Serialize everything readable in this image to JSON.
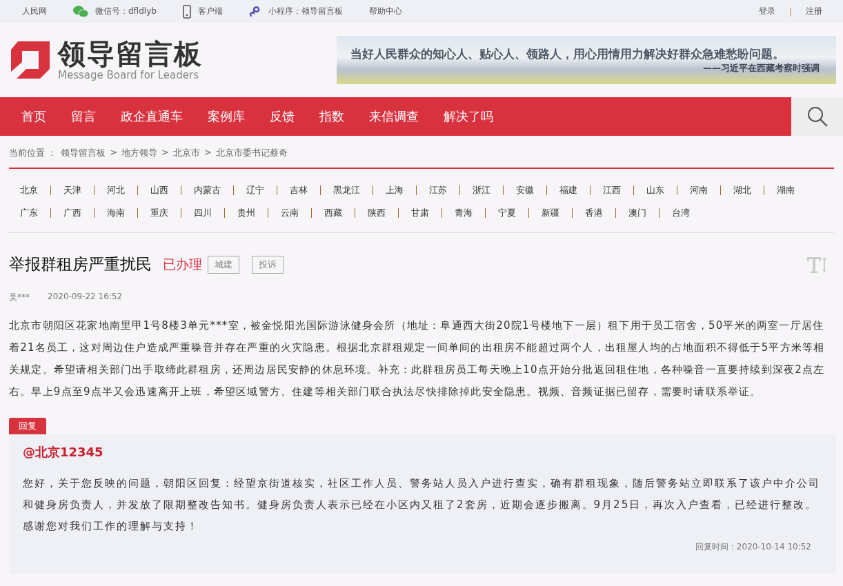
{
  "top_bar": {
    "links": [
      {
        "kind": "text",
        "label": "人民网"
      },
      {
        "kind": "wechat",
        "label": "微信号：dfldlyb"
      },
      {
        "kind": "phone",
        "label": "客户端"
      },
      {
        "kind": "miniapp",
        "label": "小程序：领导留言板"
      },
      {
        "kind": "text",
        "label": "帮助中心"
      }
    ],
    "login": "登录",
    "separator": "|",
    "register": "注册"
  },
  "header": {
    "logo_title": "领导留言板",
    "logo_subtitle": "Message Board for Leaders",
    "banner_quote": "当好人民群众的知心人、贴心人、领路人，用心用情用力解决好群众急难愁盼问题。",
    "banner_source": "——习近平在西藏考察时强调"
  },
  "nav": {
    "items": [
      {
        "label": "首页",
        "selected": false
      },
      {
        "label": "留言",
        "selected": false
      },
      {
        "label": "政企直通车",
        "selected": false
      },
      {
        "label": "案例库",
        "selected": false
      },
      {
        "label": "反馈",
        "selected": false
      },
      {
        "label": "指数",
        "selected": false
      },
      {
        "label": "来信调查",
        "selected": false
      },
      {
        "label": "解决了吗",
        "selected": false
      }
    ]
  },
  "breadcrumb": {
    "label": "当前位置 ：",
    "items": [
      "领导留言板",
      "地方领导",
      "北京市",
      "北京市委书记蔡奇"
    ],
    "separator": ">"
  },
  "regions": [
    [
      "北京",
      "天津",
      "河北",
      "山西",
      "内蒙古",
      "辽宁",
      "吉林",
      "黑龙江",
      "上海",
      "江苏",
      "浙江",
      "安徽",
      "福建",
      "江西",
      "山东",
      "河南",
      "湖北",
      "湖南"
    ],
    [
      "广东",
      "广西",
      "海南",
      "重庆",
      "四川",
      "贵州",
      "云南",
      "西藏",
      "陕西",
      "甘肃",
      "青海",
      "宁夏",
      "新疆",
      "香港",
      "澳门",
      "台湾"
    ]
  ],
  "message": {
    "title": "举报群租房严重扰民",
    "status": "已办理",
    "tags": [
      "城建",
      "投诉"
    ],
    "author": "吴***",
    "time": "2020-09-22 16:52",
    "body": "北京市朝阳区花家地南里甲1号8楼3单元***室，被金悦阳光国际游泳健身会所（地址：阜通西大街20院1号楼地下一层）租下用于员工宿舍，50平米的两室一厅居住着21名员工，这对周边住户造成严重噪音并存在严重的火灾隐患。根据北京群租规定一间单间的出租房不能超过两个人，出租屋人均的占地面积不得低于5平方米等相关规定。希望请相关部门出手取缔此群租房，还周边居民安静的休息环境。补充：此群租房员工每天晚上10点开始分批返回租住地，各种噪音一直要持续到深夜2点左右。早上9点至9点半又会迅速离开上班，希望区域警方、住建等相关部门联合执法尽快排除掉此安全隐患。视频、音频证据已留存，需要时请联系举证。"
  },
  "reply": {
    "tab": "回复",
    "responder": "@北京12345",
    "body": "您好，关于您反映的问题，朝阳区回复：经望京街道核实，社区工作人员、警务站人员入户进行查实，确有群租现象，随后警务站立即联系了该户中介公司和健身房负责人，并发放了限期整改告知书。健身房负责人表示已经在小区内又租了2套房，近期会逐步搬离。9月25日，再次入户查看，已经进行整改。感谢您对我们工作的理解与支持！",
    "time": "回复时间：2020-10-14 10:52"
  }
}
